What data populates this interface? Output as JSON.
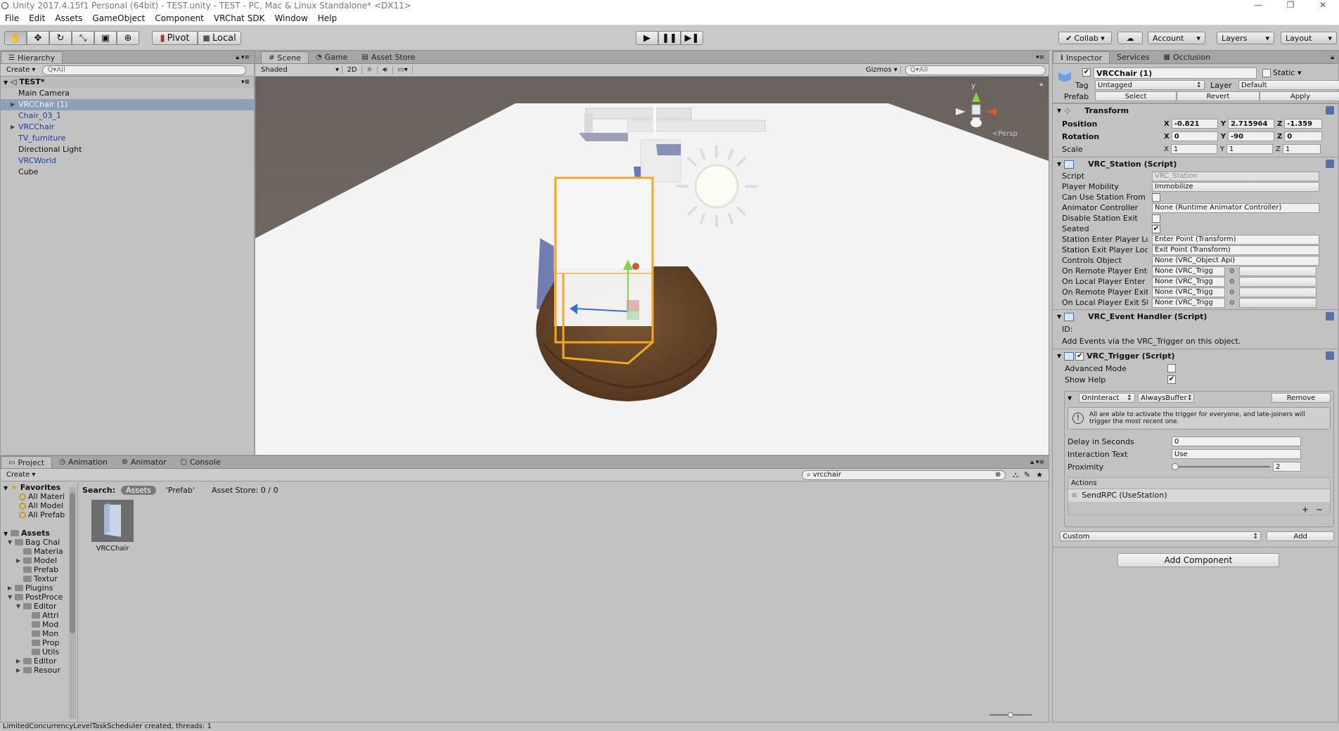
{
  "window": {
    "title": "Unity 2017.4.15f1 Personal (64bit) - TEST.unity - TEST - PC, Mac & Linux Standalone* <DX11>",
    "controls": [
      "—",
      "❐",
      "✕"
    ]
  },
  "menu": [
    "File",
    "Edit",
    "Assets",
    "GameObject",
    "Component",
    "VRChat SDK",
    "Window",
    "Help"
  ],
  "toolbar": {
    "tools": [
      "hand-icon",
      "move-icon",
      "rotate-icon",
      "scale-icon",
      "rect-icon",
      "transform-icon"
    ],
    "pivot": "Pivot",
    "local": "Local",
    "collab": "Collab ▾",
    "account": "Account",
    "layers": "Layers",
    "layout": "Layout"
  },
  "hierarchy": {
    "tab": "Hierarchy",
    "create": "Create ▾",
    "search_placeholder": "Q▾All",
    "scene": "TEST*",
    "items": [
      {
        "label": "Main Camera",
        "prefab": false,
        "selected": false,
        "arrow": false
      },
      {
        "label": "VRCChair (1)",
        "prefab": true,
        "selected": true,
        "arrow": true
      },
      {
        "label": "Chair_03_1",
        "prefab": true,
        "selected": false,
        "arrow": false
      },
      {
        "label": "VRCChair",
        "prefab": true,
        "selected": false,
        "arrow": true
      },
      {
        "label": "TV_furniture",
        "prefab": true,
        "selected": false,
        "arrow": false
      },
      {
        "label": "Directional Light",
        "prefab": false,
        "selected": false,
        "arrow": false
      },
      {
        "label": "VRCWorld",
        "prefab": true,
        "selected": false,
        "arrow": false
      },
      {
        "label": "Cube",
        "prefab": false,
        "selected": false,
        "arrow": false
      }
    ]
  },
  "scene": {
    "tabs": [
      "Scene",
      "Game",
      "Asset Store"
    ],
    "shading": "Shaded",
    "mode2d": "2D",
    "gizmos": "Gizmos ▾",
    "search_placeholder": "Q▾All",
    "persp": "<Persp",
    "gizmo_y": "y"
  },
  "project": {
    "tabs": [
      "Project",
      "Animation",
      "Animator",
      "Console"
    ],
    "create": "Create ▾",
    "search_value": "vrcchair",
    "search_label": "Search:",
    "scope_assets": "Assets",
    "scope_prefab": "'Prefab'",
    "asset_store": "Asset Store: 0 / 0",
    "favorites_label": "Favorites",
    "favorites": [
      "All Materi",
      "All Model",
      "All Prefab"
    ],
    "assets_label": "Assets",
    "tree": [
      {
        "label": "Bag Chai",
        "depth": 1,
        "arrow": "open"
      },
      {
        "label": "Materia",
        "depth": 2,
        "arrow": ""
      },
      {
        "label": "Model",
        "depth": 2,
        "arrow": "closed"
      },
      {
        "label": "Prefab",
        "depth": 2,
        "arrow": ""
      },
      {
        "label": "Textur",
        "depth": 2,
        "arrow": ""
      },
      {
        "label": "Plugins",
        "depth": 1,
        "arrow": "closed"
      },
      {
        "label": "PostProce",
        "depth": 1,
        "arrow": "open"
      },
      {
        "label": "Editor",
        "depth": 2,
        "arrow": "open"
      },
      {
        "label": "Attri",
        "depth": 3,
        "arrow": ""
      },
      {
        "label": "Mod",
        "depth": 3,
        "arrow": ""
      },
      {
        "label": "Mon",
        "depth": 3,
        "arrow": ""
      },
      {
        "label": "Prop",
        "depth": 3,
        "arrow": ""
      },
      {
        "label": "Utils",
        "depth": 3,
        "arrow": ""
      },
      {
        "label": "Editor",
        "depth": 2,
        "arrow": "closed"
      },
      {
        "label": "Resour",
        "depth": 2,
        "arrow": "closed"
      }
    ],
    "asset_name": "VRCChair"
  },
  "inspector": {
    "tabs": [
      "Inspector",
      "Services",
      "Occlusion"
    ],
    "object_name": "VRCChair (1)",
    "static_label": "Static ▾",
    "tag_label": "Tag",
    "tag_value": "Untagged",
    "layer_label": "Layer",
    "layer_value": "Default",
    "prefab_label": "Prefab",
    "prefab_buttons": [
      "Select",
      "Revert",
      "Apply"
    ],
    "transform": {
      "title": "Transform",
      "position_label": "Position",
      "rotation_label": "Rotation",
      "scale_label": "Scale",
      "position": {
        "x": "-0.821",
        "y": "2.715964",
        "z": "-1.359"
      },
      "rotation": {
        "x": "0",
        "y": "-90",
        "z": "0"
      },
      "scale": {
        "x": "1",
        "y": "1",
        "z": "1"
      }
    },
    "station": {
      "title": "VRC_Station (Script)",
      "rows": [
        {
          "label": "Script",
          "value": "VRC_Station",
          "type": "disabled"
        },
        {
          "label": "Player Mobility",
          "value": "Immobilize",
          "type": "popup"
        },
        {
          "label": "Can Use Station From Sta",
          "value": "",
          "type": "check",
          "checked": false
        },
        {
          "label": "Animator Controller",
          "value": "None (Runtime Animator Controller)",
          "type": "field"
        },
        {
          "label": "Disable Station Exit",
          "value": "",
          "type": "check",
          "checked": false
        },
        {
          "label": "Seated",
          "value": "",
          "type": "check",
          "checked": true
        },
        {
          "label": "Station Enter Player Locat",
          "value": "Enter Point (Transform)",
          "type": "field"
        },
        {
          "label": "Station Exit Player Locatic",
          "value": "Exit Point (Transform)",
          "type": "field"
        },
        {
          "label": "Controls Object",
          "value": "None (VRC_Object Api)",
          "type": "field"
        },
        {
          "label": "On Remote Player Enter S",
          "value": "None (VRC_Trigg",
          "type": "split"
        },
        {
          "label": "On Local Player Enter Sta",
          "value": "None (VRC_Trigg",
          "type": "split"
        },
        {
          "label": "On Remote Player Exit St",
          "value": "None (VRC_Trigg",
          "type": "split"
        },
        {
          "label": "On Local Player Exit Stati",
          "value": "None (VRC_Trigg",
          "type": "split"
        }
      ]
    },
    "event_handler": {
      "title": "VRC_Event Handler (Script)",
      "id_label": "ID:",
      "note": "Add Events via the VRC_Trigger on this object."
    },
    "trigger": {
      "title": "VRC_Trigger (Script)",
      "advanced_label": "Advanced Mode",
      "show_help_label": "Show Help",
      "on_interact": "OnInteract",
      "always_buffer": "AlwaysBuffer",
      "remove": "Remove",
      "help_text": "All are able to activate the trigger for everyone, and late-joiners will trigger the most recent one.",
      "delay_label": "Delay in Seconds",
      "delay_value": "0",
      "interaction_label": "Interaction Text",
      "interaction_value": "Use",
      "proximity_label": "Proximity",
      "proximity_value": "2",
      "proximity_fraction": 0.0,
      "actions_label": "Actions",
      "action_item": "SendRPC (UseStation)",
      "custom": "Custom",
      "add": "Add"
    },
    "add_component": "Add Component"
  },
  "status": "LimitedConcurrencyLevelTaskScheduler created, threads: 1",
  "colors": {
    "selection": "#8e9fb8",
    "prefab_text": "#1a3ea8",
    "chair_outline": "#f5a623",
    "bag_brown": "#6b4a2a"
  }
}
